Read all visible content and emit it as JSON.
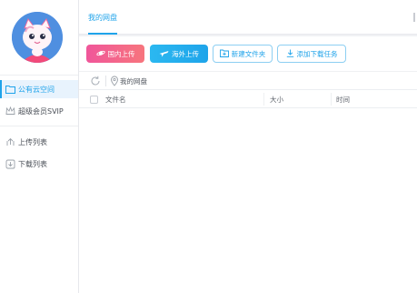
{
  "sidebar": {
    "items": [
      {
        "label": "公有云空间",
        "icon": "folder-icon",
        "active": true
      },
      {
        "label": "超级会员SVIP",
        "icon": "vip-crown-icon",
        "active": false
      },
      {
        "label": "上传列表",
        "icon": "upload-list-icon",
        "active": false
      },
      {
        "label": "下载列表",
        "icon": "download-list-icon",
        "active": false
      }
    ]
  },
  "header": {
    "tab_label": "我的网盘"
  },
  "toolbar": {
    "domestic_upload_label": "国内上传",
    "overseas_upload_label": "海外上传",
    "new_folder_label": "新建文件夹",
    "add_download_label": "添加下载任务"
  },
  "breadcrumb": {
    "path": "我的网盘"
  },
  "table": {
    "columns": [
      "文件名",
      "大小",
      "时间"
    ]
  },
  "colors": {
    "accent": "#1fa3ea",
    "domestic_button": "#f0569a",
    "overseas_button": "#2bb8f0",
    "avatar_bg": "#4f8fe0"
  }
}
